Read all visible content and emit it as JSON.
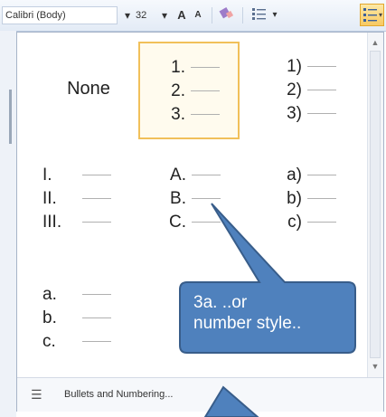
{
  "toolbar": {
    "font_name": "Calibri (Body)",
    "font_size": "32",
    "grow_font": "A",
    "shrink_font": "A",
    "dropdown_glyph": "▾",
    "clear_format_icon": "clear-formatting-icon",
    "bullets_icon": "bullets-icon",
    "numbering_icon": "numbering-icon"
  },
  "gallery": {
    "none_label": "None",
    "styles": [
      {
        "id": "none",
        "items": []
      },
      {
        "id": "arabic-dot",
        "items": [
          "1.",
          "2.",
          "3."
        ],
        "selected": true
      },
      {
        "id": "arabic-paren",
        "items": [
          "1)",
          "2)",
          "3)"
        ]
      },
      {
        "id": "roman-upper",
        "items": [
          "I.",
          "II.",
          "III."
        ]
      },
      {
        "id": "alpha-upper",
        "items": [
          "A.",
          "B.",
          "C."
        ]
      },
      {
        "id": "alpha-lower-paren",
        "items": [
          "a)",
          "b)",
          "c)"
        ]
      },
      {
        "id": "alpha-lower-dot",
        "items": [
          "a.",
          "b.",
          "c."
        ]
      }
    ]
  },
  "footer": {
    "label": "Bullets and Numbering..."
  },
  "callout": {
    "line1": "3a. ..or",
    "line2": "number style..",
    "fill": "#4f81bd",
    "stroke": "#385d8a"
  }
}
